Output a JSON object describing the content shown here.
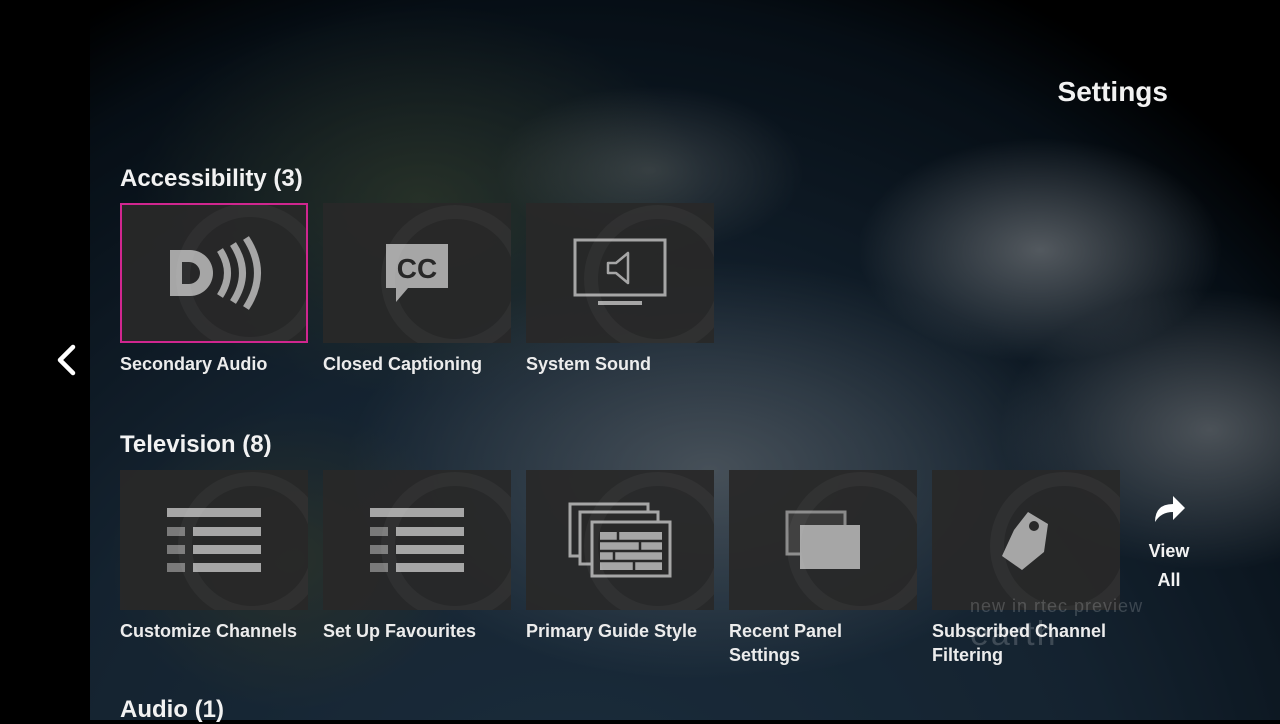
{
  "page": {
    "title": "Settings"
  },
  "icons": {
    "back": "chevron-left-icon",
    "view_all": "forward-arrow-icon"
  },
  "colors": {
    "focus_border": "#d0268f",
    "tile_background": "#282828",
    "icon_gray": "#a6a6a6"
  },
  "sections": {
    "accessibility": {
      "title": "Accessibility (3)",
      "tiles": [
        {
          "label": "Secondary Audio",
          "icon": "audio-description-icon",
          "focused": true
        },
        {
          "label": "Closed Captioning",
          "icon": "closed-captions-icon"
        },
        {
          "label": "System Sound",
          "icon": "monitor-speaker-icon"
        }
      ]
    },
    "television": {
      "title": "Television (8)",
      "tiles": [
        {
          "label": "Customize Channels",
          "icon": "channel-list-icon"
        },
        {
          "label": "Set Up Favourites",
          "icon": "favourites-list-icon"
        },
        {
          "label": "Primary Guide Style",
          "icon": "guide-grid-icon"
        },
        {
          "label": "Recent Panel Settings",
          "icon": "recent-panel-icon"
        },
        {
          "label": "Subscribed Channel Filtering",
          "icon": "tag-icon"
        }
      ],
      "view_all_line1": "View",
      "view_all_line2": "All"
    },
    "audio": {
      "title": "Audio (1)"
    }
  },
  "background_watermark": {
    "line1": "new in rtec preview",
    "line2": "earth"
  }
}
